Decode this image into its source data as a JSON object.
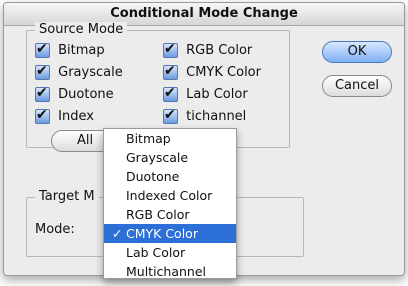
{
  "dialog": {
    "title": "Conditional Mode Change"
  },
  "source_mode": {
    "legend": "Source Mode",
    "checkboxes": [
      "Bitmap",
      "RGB Color",
      "Grayscale",
      "CMYK Color",
      "Duotone",
      "Lab Color",
      "Indexed Color",
      "Multichannel"
    ],
    "visible_text": {
      "indexed": "Index",
      "multichannel": "tichannel"
    },
    "all_button": "All"
  },
  "target_mode": {
    "legend": "Target M",
    "mode_label": "Mode:",
    "selected": "CMYK Color"
  },
  "buttons": {
    "ok": "OK",
    "cancel": "Cancel"
  },
  "popup": {
    "items": [
      "Bitmap",
      "Grayscale",
      "Duotone",
      "Indexed Color",
      "RGB Color",
      "CMYK Color",
      "Lab Color",
      "Multichannel"
    ],
    "selected_index": 5,
    "check": "✓"
  },
  "colors": {
    "selection": "#2c6fd6",
    "window": "#ececec",
    "checkbox": "#6d9be0"
  }
}
